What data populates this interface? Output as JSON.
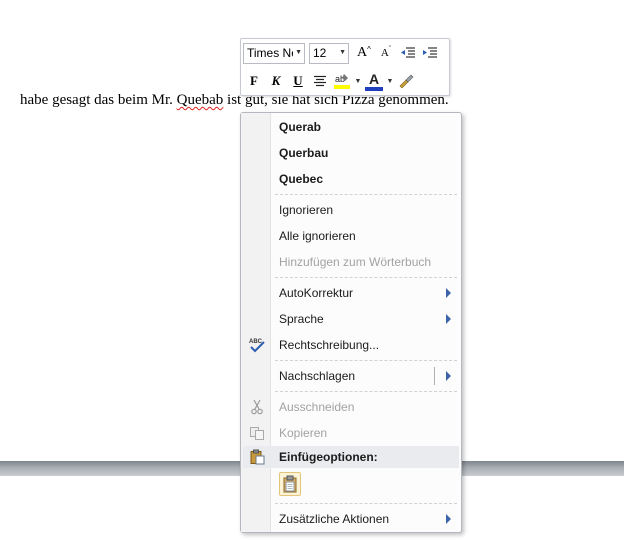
{
  "document": {
    "text_before": "habe gesagt das beim Mr. ",
    "misspelled_word": "Quebab",
    "text_after": " ist gut, sie hat sich Pizza genommen."
  },
  "mini_toolbar": {
    "font_name": "Times Ne",
    "font_size": "12",
    "grow_font_label": "A",
    "shrink_font_label": "A",
    "bold_label": "F",
    "italic_label": "K",
    "underline_label": "U",
    "font_color_label": "A",
    "highlight_color": "#ffff00",
    "font_color": "#1f3fbf"
  },
  "context_menu": {
    "suggestions": [
      "Querab",
      "Querbau",
      "Quebec"
    ],
    "ignore": "Ignorieren",
    "ignore_all": "Alle ignorieren",
    "add_to_dictionary": "Hinzufügen zum Wörterbuch",
    "autocorrect": "AutoKorrektur",
    "language": "Sprache",
    "spelling": "Rechtschreibung...",
    "lookup": "Nachschlagen",
    "cut": "Ausschneiden",
    "copy": "Kopieren",
    "paste_options": "Einfügeoptionen:",
    "additional_actions": "Zusätzliche Aktionen"
  },
  "colors": {
    "accent_arrow": "#3d64a8",
    "spelling_underline": "#e02020",
    "disabled_text": "#a2a2a2"
  }
}
